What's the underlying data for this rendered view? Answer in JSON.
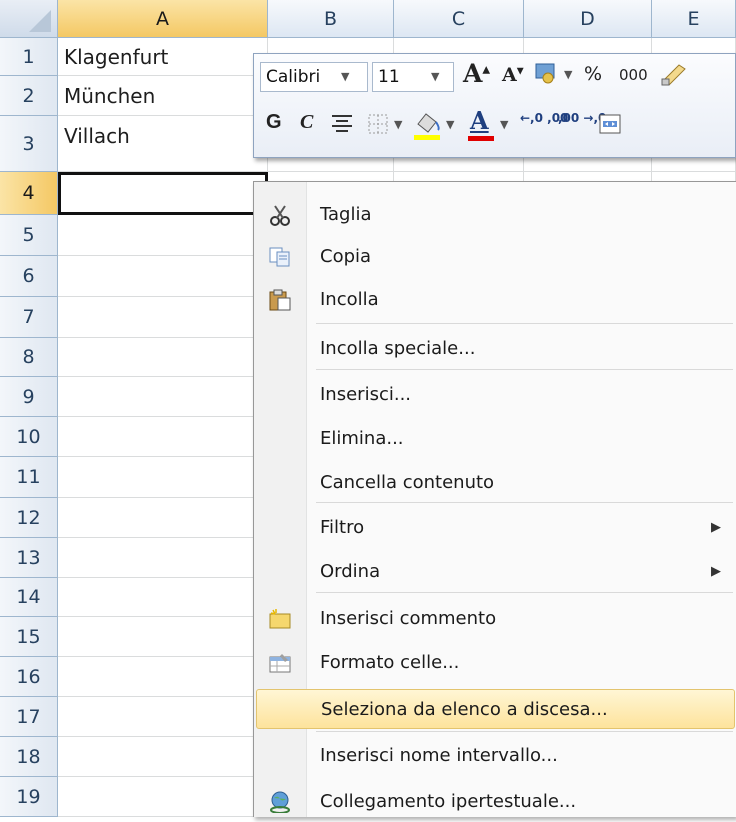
{
  "columns": [
    "A",
    "B",
    "C",
    "D",
    "E"
  ],
  "rows": [
    "1",
    "2",
    "3",
    "4",
    "5",
    "6",
    "7",
    "8",
    "9",
    "10",
    "11",
    "12",
    "13",
    "14",
    "15",
    "16",
    "17",
    "18",
    "19"
  ],
  "cells": {
    "A1": "Klagenfurt",
    "A2": "München",
    "A3": "Villach"
  },
  "active_cell": "A4",
  "mini_toolbar": {
    "font_name": "Calibri",
    "font_size": "11",
    "grow_font": "A",
    "shrink_font": "A",
    "percent": "%",
    "thousands": "000",
    "bold": "G",
    "italic": "C",
    "font_color_letter": "A",
    "increase_decimal": "←,0 ,00",
    "decrease_decimal": ",00 →,0"
  },
  "context_menu": [
    {
      "label": "Taglia",
      "icon": "scissors-icon"
    },
    {
      "label": "Copia",
      "icon": "copy-icon"
    },
    {
      "label": "Incolla",
      "icon": "paste-icon"
    },
    {
      "label": "Incolla speciale..."
    },
    {
      "label": "Inserisci..."
    },
    {
      "label": "Elimina..."
    },
    {
      "label": "Cancella contenuto"
    },
    {
      "label": "Filtro",
      "submenu": true
    },
    {
      "label": "Ordina",
      "submenu": true
    },
    {
      "label": "Inserisci commento",
      "icon": "comment-icon"
    },
    {
      "label": "Formato celle...",
      "icon": "format-cells-icon"
    },
    {
      "label": "Seleziona da elenco a discesa...",
      "highlighted": true
    },
    {
      "label": "Inserisci nome intervallo..."
    },
    {
      "label": "Collegamento ipertestuale...",
      "icon": "hyperlink-icon"
    }
  ],
  "colors": {
    "header_active": "#f4c864",
    "menu_highlight": "#fde39c",
    "font_color_bar": "#e00000",
    "highlight_bar": "#ffff00"
  }
}
